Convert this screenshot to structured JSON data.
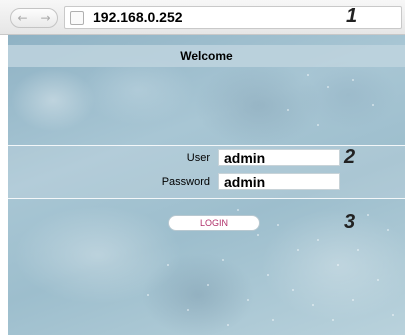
{
  "browser": {
    "back_glyph": "←",
    "forward_glyph": "→",
    "url": "192.168.0.252"
  },
  "markers": {
    "m1": "1",
    "m2": "2",
    "m3": "3"
  },
  "page": {
    "welcome": "Welcome",
    "user_label": "User",
    "user_value": "admin",
    "password_label": "Password",
    "password_value": "admin",
    "login_label": "LOGIN"
  },
  "colors": {
    "accent": "#b0306a",
    "background": "#a8c6d4"
  }
}
